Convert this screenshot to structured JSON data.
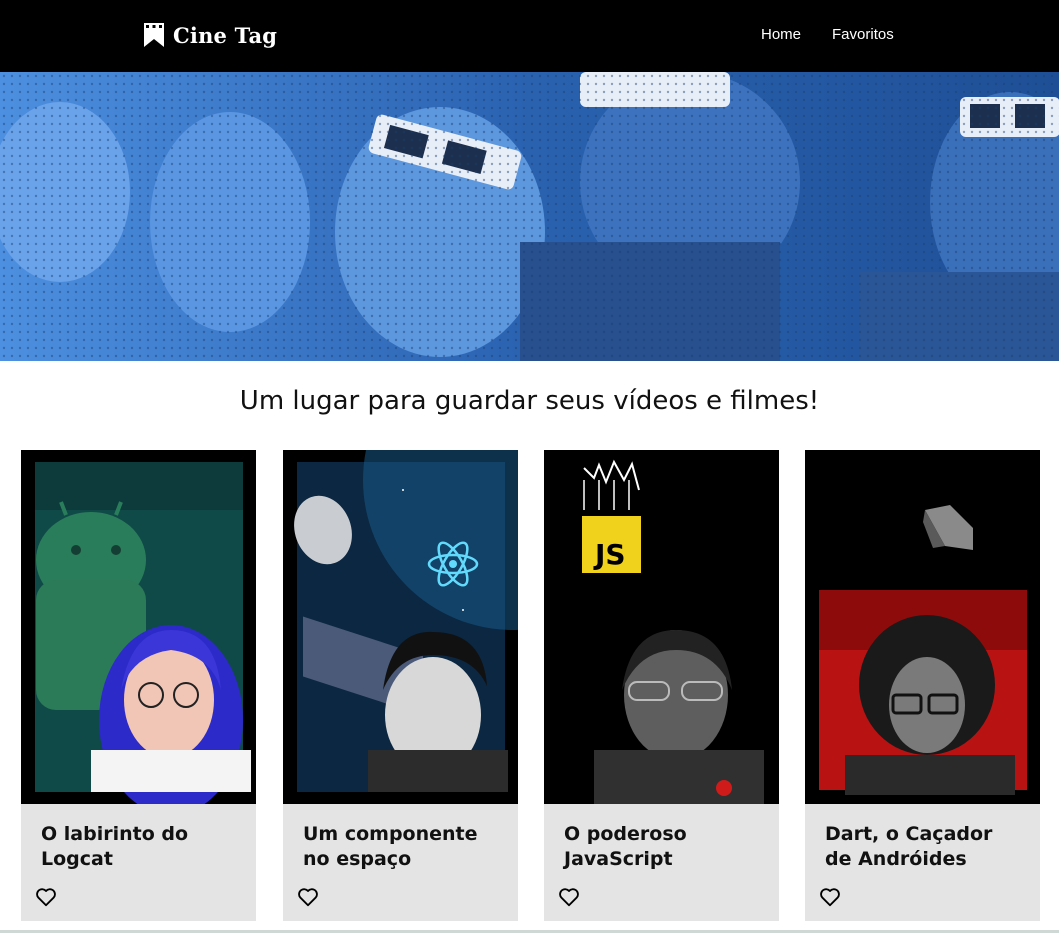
{
  "header": {
    "logo_text": "Cine Tag",
    "nav": [
      {
        "label": "Home"
      },
      {
        "label": "Favoritos"
      }
    ]
  },
  "main": {
    "tagline": "Um lugar para guardar seus vídeos e filmes!",
    "cards": [
      {
        "title": "O labirinto do Logcat",
        "favorited": false
      },
      {
        "title": "Um componente no espaço",
        "favorited": false
      },
      {
        "title": "O poderoso JavaScript",
        "thumb_badge": "JS",
        "favorited": false
      },
      {
        "title": "Dart, o Caçador de Andróides",
        "favorited": false
      }
    ]
  },
  "colors": {
    "header_bg": "#000000",
    "banner_tint": "#2f6fc0",
    "card_bg": "#e4e4e4"
  }
}
